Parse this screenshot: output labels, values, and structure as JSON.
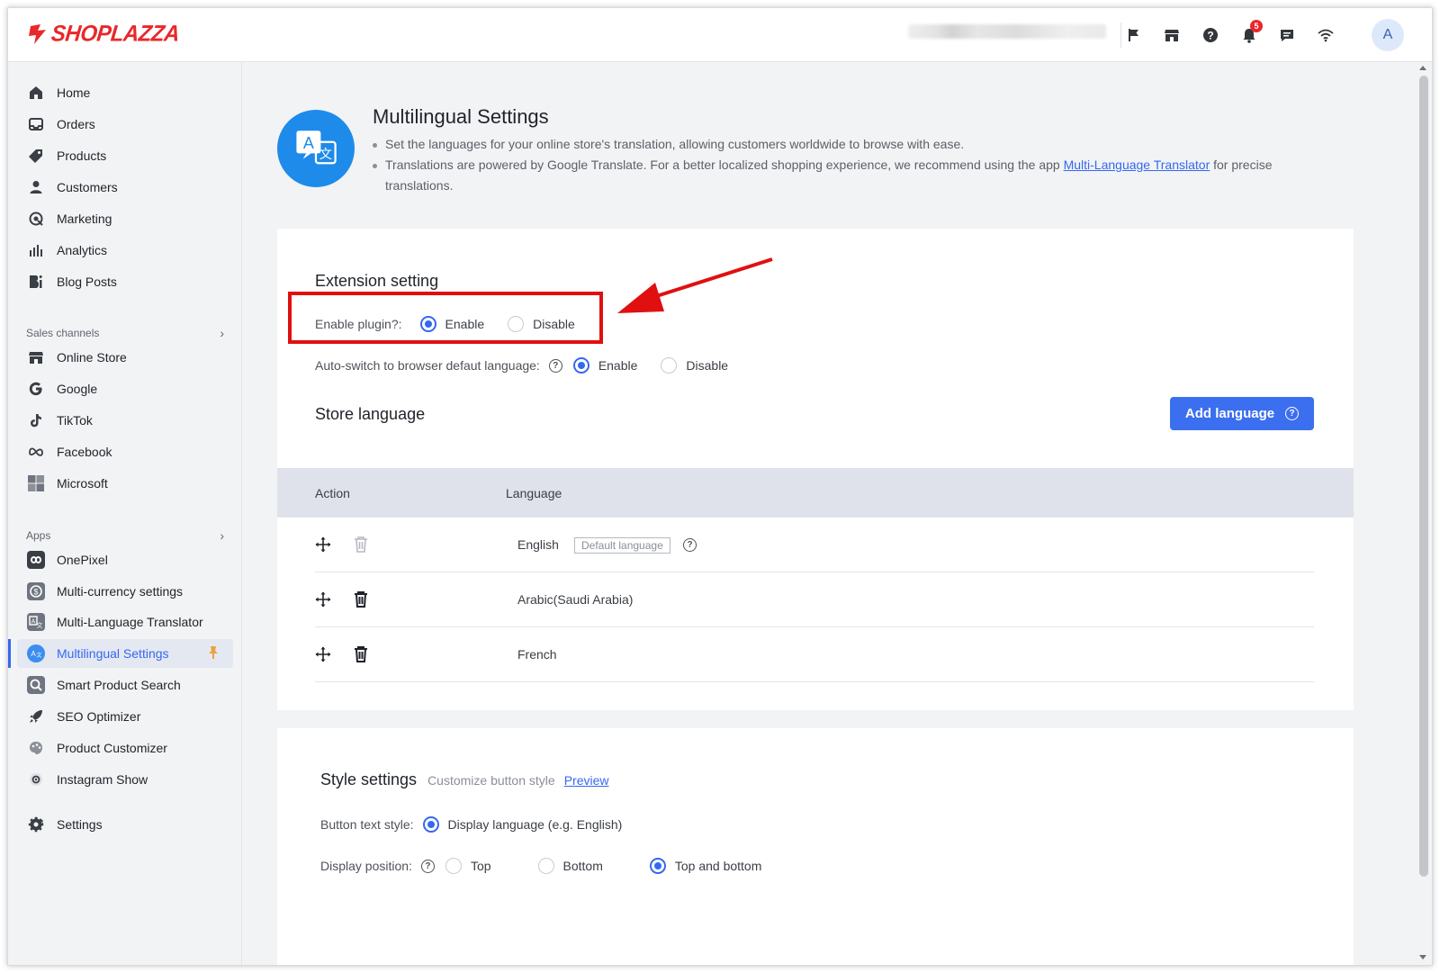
{
  "brand": {
    "name": "SHOPLAZZA",
    "color": "#e8282b"
  },
  "topbar": {
    "icons": [
      "flag-icon",
      "store-icon",
      "help-circle-icon",
      "bell-icon",
      "chat-icon",
      "wifi-icon"
    ],
    "notification_count": "5",
    "avatar_initial": "A"
  },
  "sidebar": {
    "main_items": [
      {
        "label": "Home",
        "icon": "home-icon"
      },
      {
        "label": "Orders",
        "icon": "orders-icon"
      },
      {
        "label": "Products",
        "icon": "tag-icon"
      },
      {
        "label": "Customers",
        "icon": "user-icon"
      },
      {
        "label": "Marketing",
        "icon": "marketing-icon"
      },
      {
        "label": "Analytics",
        "icon": "analytics-icon"
      },
      {
        "label": "Blog Posts",
        "icon": "blog-icon"
      }
    ],
    "sales_channels_label": "Sales channels",
    "sales_channels": [
      {
        "label": "Online Store",
        "icon": "store-icon"
      },
      {
        "label": "Google",
        "icon": "google-icon"
      },
      {
        "label": "TikTok",
        "icon": "tiktok-icon"
      },
      {
        "label": "Facebook",
        "icon": "meta-icon"
      },
      {
        "label": "Microsoft",
        "icon": "microsoft-icon"
      }
    ],
    "apps_label": "Apps",
    "apps": [
      {
        "label": "OnePixel",
        "icon": "onepixel-icon"
      },
      {
        "label": "Multi-currency settings",
        "icon": "currency-app-icon"
      },
      {
        "label": "Multi-Language Translator",
        "icon": "translator-app-icon"
      },
      {
        "label": "Multilingual Settings",
        "icon": "multilingual-app-icon",
        "active": true
      },
      {
        "label": "Smart Product Search",
        "icon": "search-app-icon"
      },
      {
        "label": "SEO Optimizer",
        "icon": "rocket-icon"
      },
      {
        "label": "Product Customizer",
        "icon": "customizer-icon"
      },
      {
        "label": "Instagram Show",
        "icon": "instagram-icon"
      }
    ],
    "settings_label": "Settings",
    "accent": "#3568f0"
  },
  "page": {
    "title": "Multilingual Settings",
    "bullet1": "Set the languages for your online store's translation, allowing customers worldwide to browse with ease.",
    "bullet2_before": "Translations are powered by Google Translate. For a better localized shopping experience, we recommend using the app ",
    "bullet2_link": "Multi-Language Translator",
    "bullet2_after": " for precise translations."
  },
  "extension": {
    "title": "Extension setting",
    "enable_plugin_label": "Enable plugin?:",
    "enable_plugin_value": "Enable",
    "auto_switch_label": "Auto-switch to browser defaut language:",
    "auto_switch_value": "Enable",
    "option_enable": "Enable",
    "option_disable": "Disable"
  },
  "store_language": {
    "title": "Store language",
    "add_button": "Add language",
    "columns": [
      "Action",
      "Language"
    ],
    "rows": [
      {
        "language": "English",
        "default": true,
        "default_tag": "Default language"
      },
      {
        "language": "Arabic(Saudi Arabia)",
        "default": false
      },
      {
        "language": "French",
        "default": false
      }
    ]
  },
  "style_settings": {
    "title": "Style settings",
    "subtitle": "Customize button style",
    "preview_link": "Preview",
    "button_text_label": "Button text style:",
    "button_text_option": "Display language (e.g. English)",
    "display_position_label": "Display position:",
    "position_options": [
      "Top",
      "Bottom",
      "Top and bottom"
    ],
    "position_selected": "Top and bottom"
  },
  "annotation_color": "#e01010"
}
